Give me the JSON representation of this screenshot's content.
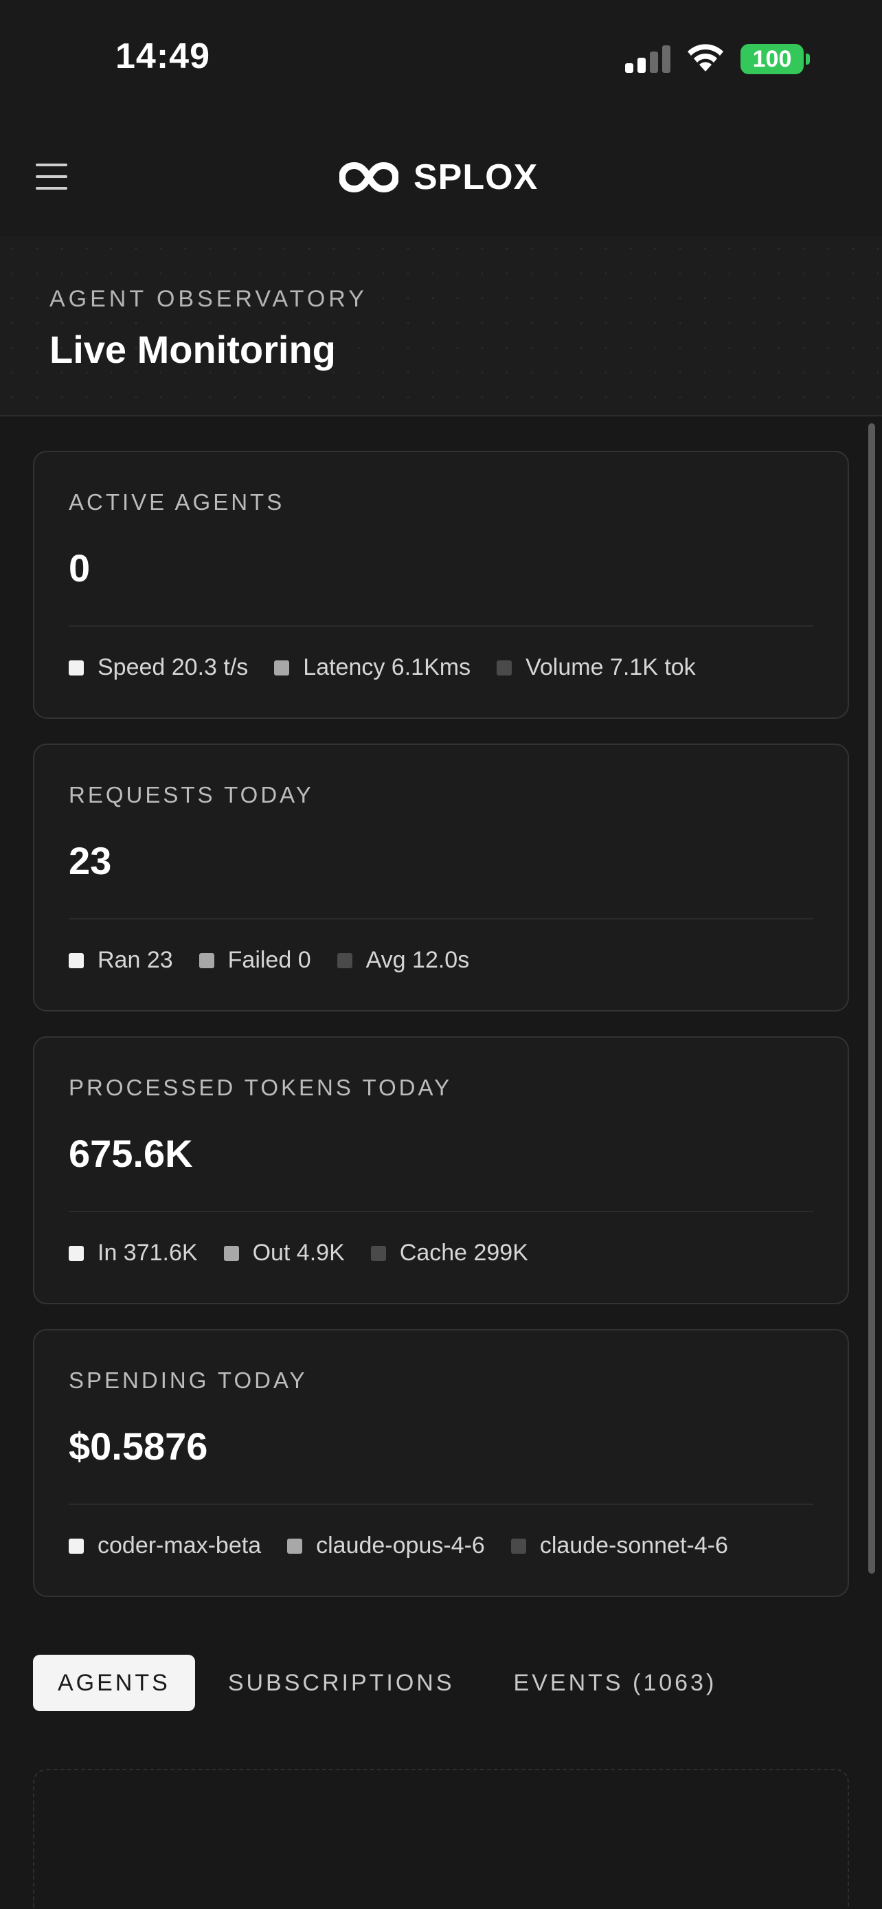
{
  "status_bar": {
    "time": "14:49",
    "battery": "100"
  },
  "header": {
    "brand": "SPLOX"
  },
  "banner": {
    "eyebrow": "AGENT OBSERVATORY",
    "title": "Live Monitoring"
  },
  "cards": [
    {
      "label": "ACTIVE AGENTS",
      "value": "0",
      "legend": [
        "Speed 20.3 t/s",
        "Latency 6.1Kms",
        "Volume 7.1K tok"
      ]
    },
    {
      "label": "REQUESTS TODAY",
      "value": "23",
      "legend": [
        "Ran 23",
        "Failed 0",
        "Avg 12.0s"
      ]
    },
    {
      "label": "PROCESSED TOKENS TODAY",
      "value": "675.6K",
      "legend": [
        "In 371.6K",
        "Out 4.9K",
        "Cache 299K"
      ]
    },
    {
      "label": "SPENDING TODAY",
      "value": "$0.5876",
      "legend": [
        "coder-max-beta",
        "claude-opus-4-6",
        "claude-sonnet-4-6"
      ]
    }
  ],
  "legend_colors": [
    "#f2f2f2",
    "#a8a8a8",
    "#4a4a4a"
  ],
  "tabs": [
    "AGENTS",
    "SUBSCRIPTIONS",
    "EVENTS (1063)"
  ],
  "active_tab": "AGENTS",
  "colors": {
    "background": "#181818",
    "card": "#1c1c1c",
    "battery": "#34c759"
  }
}
